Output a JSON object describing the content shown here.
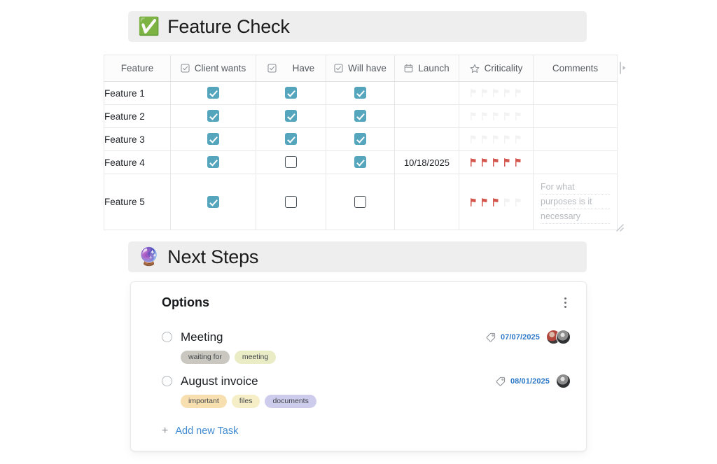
{
  "sections": {
    "feature_check": {
      "emoji": "✅",
      "emoji_name": "white-check-mark-emoji",
      "title": "Feature Check"
    },
    "next_steps": {
      "emoji": "🔮",
      "emoji_name": "crystal-ball-emoji",
      "title": "Next Steps"
    }
  },
  "table": {
    "columns": [
      {
        "label": "Feature",
        "icon": "none"
      },
      {
        "label": "Client wants",
        "icon": "checkbox-icon"
      },
      {
        "label": "Have",
        "icon": "checkbox-icon"
      },
      {
        "label": "Will have",
        "icon": "checkbox-icon"
      },
      {
        "label": "Launch",
        "icon": "calendar-icon"
      },
      {
        "label": "Criticality",
        "icon": "star-icon"
      },
      {
        "label": "Comments",
        "icon": "none"
      }
    ],
    "rows": [
      {
        "feature": "Feature 1",
        "client_wants": true,
        "have": true,
        "will_have": true,
        "launch": "",
        "criticality": 0,
        "criticality_max": 5,
        "comments": ""
      },
      {
        "feature": "Feature 2",
        "client_wants": true,
        "have": true,
        "will_have": true,
        "launch": "",
        "criticality": 0,
        "criticality_max": 5,
        "comments": ""
      },
      {
        "feature": "Feature 3",
        "client_wants": true,
        "have": true,
        "will_have": true,
        "launch": "",
        "criticality": 0,
        "criticality_max": 5,
        "comments": ""
      },
      {
        "feature": "Feature 4",
        "client_wants": true,
        "have": false,
        "will_have": true,
        "launch": "10/18/2025",
        "criticality": 5,
        "criticality_max": 5,
        "comments": ""
      },
      {
        "feature": "Feature 5",
        "client_wants": true,
        "have": false,
        "will_have": false,
        "launch": "",
        "criticality": 3,
        "criticality_max": 5,
        "comments": "For what purposes is it necessary",
        "comment_lines": [
          "For what",
          "purposes is it",
          "necessary"
        ]
      }
    ],
    "add_column_icon": "add-column-arrow-icon",
    "resize_handle_icon": "resize-handle-icon"
  },
  "options_card": {
    "title": "Options",
    "menu_icon": "kebab-menu-icon",
    "tasks": [
      {
        "name": "Meeting",
        "done": false,
        "date": "07/07/2025",
        "tag_icon": "tag-icon",
        "assignees": 2,
        "chips": [
          {
            "label": "waiting for",
            "color": "#c9c7c0"
          },
          {
            "label": "meeting",
            "color": "#eaecc6"
          }
        ]
      },
      {
        "name": "August invoice",
        "done": false,
        "date": "08/01/2025",
        "tag_icon": "tag-icon",
        "assignees": 1,
        "chips": [
          {
            "label": "important",
            "color": "#f7dfb0"
          },
          {
            "label": "files",
            "color": "#f6eec7"
          },
          {
            "label": "documents",
            "color": "#cdccec"
          }
        ]
      }
    ],
    "add_task": {
      "plus": "+",
      "label": "Add new Task"
    }
  },
  "colors": {
    "checkbox_checked": "#55a5bd",
    "flag_active": "#d4574f",
    "flag_inactive": "#f3f3f3",
    "date_text": "#2e79c7",
    "link_text": "#3f8ad0",
    "banner_bg": "#eeeeee"
  }
}
